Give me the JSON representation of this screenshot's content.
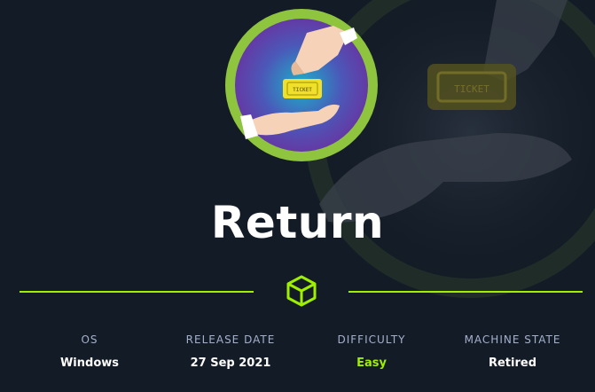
{
  "machine": {
    "name": "Return",
    "stats": [
      {
        "label": "OS",
        "value": "Windows"
      },
      {
        "label": "RELEASE DATE",
        "value": "27 Sep 2021"
      },
      {
        "label": "DIFFICULTY",
        "value": "Easy"
      },
      {
        "label": "MACHINE STATE",
        "value": "Retired"
      }
    ],
    "logo_ticket_text": "TICKET"
  },
  "colors": {
    "background": "#131b26",
    "accent_green": "#9fef00",
    "label_gray": "#a4b1cd",
    "logo_ring": "#8fc43f",
    "logo_inner": "#5a3aa8"
  },
  "icons": {
    "logo": "hand-ticket-icon",
    "divider": "cube-icon"
  }
}
